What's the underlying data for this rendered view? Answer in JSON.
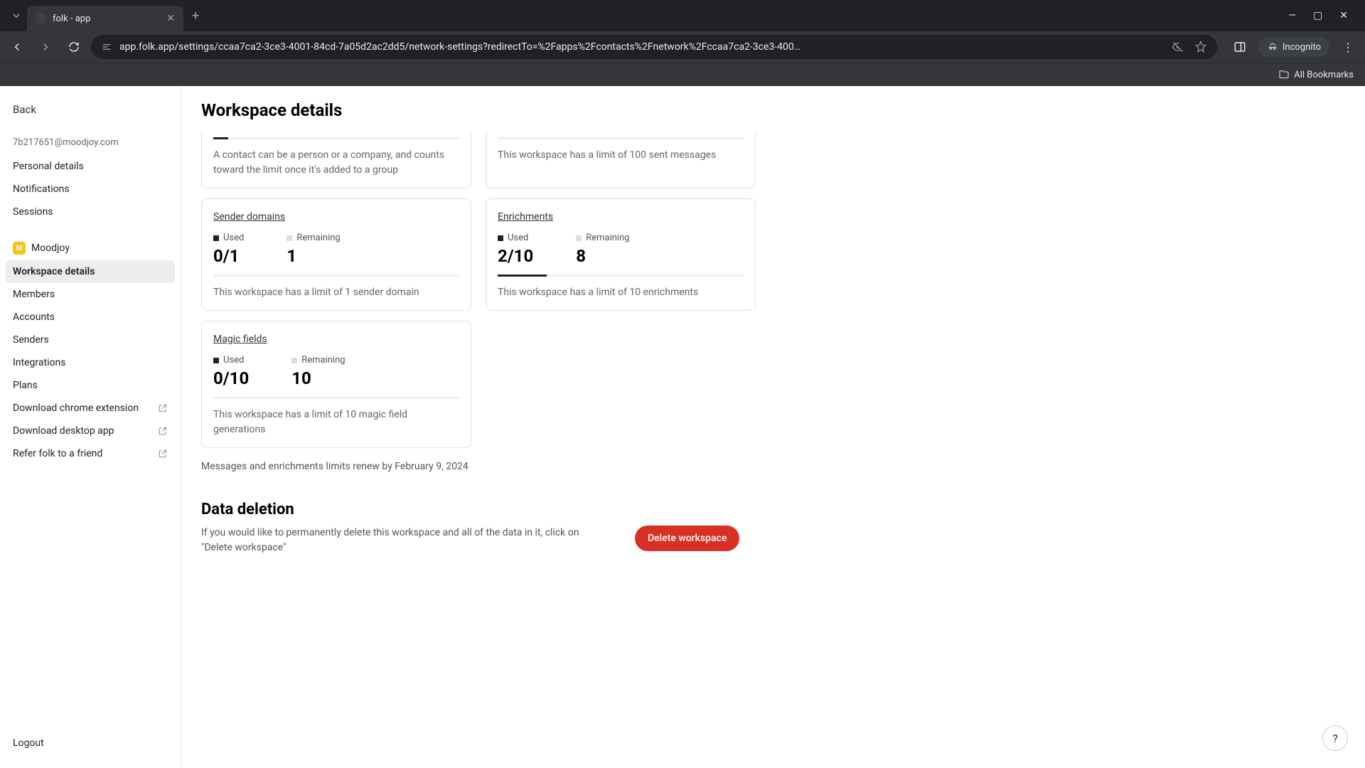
{
  "browser": {
    "tab_title": "folk - app",
    "url": "app.folk.app/settings/ccaa7ca2-3ce3-4001-84cd-7a05d2ac2dd5/network-settings?redirectTo=%2Fapps%2Fcontacts%2Fnetwork%2Fccaa7ca2-3ce3-400…",
    "incognito_label": "Incognito",
    "all_bookmarks": "All Bookmarks"
  },
  "sidebar": {
    "back": "Back",
    "email": "7b217651@moodjoy.com",
    "items": {
      "personal": "Personal details",
      "notifications": "Notifications",
      "sessions": "Sessions",
      "workspace_name": "Moodjoy",
      "workspace_details": "Workspace details",
      "members": "Members",
      "accounts": "Accounts",
      "senders": "Senders",
      "integrations": "Integrations",
      "plans": "Plans",
      "chrome_ext": "Download chrome extension",
      "desktop_app": "Download desktop app",
      "refer": "Refer folk to a friend",
      "logout": "Logout"
    }
  },
  "main": {
    "title": "Workspace details",
    "contact_card_desc": "A contact can be a person or a company, and counts toward the limit once it's added to a group",
    "messages_card_desc": "This workspace has a limit of 100 sent messages",
    "sender_domains": {
      "title": "Sender domains",
      "used_label": "Used",
      "used_value": "0/1",
      "remaining_label": "Remaining",
      "remaining_value": "1",
      "desc": "This workspace has a limit of 1 sender domain"
    },
    "enrichments": {
      "title": "Enrichments",
      "used_label": "Used",
      "used_value": "2/10",
      "remaining_label": "Remaining",
      "remaining_value": "8",
      "desc": "This workspace has a limit of 10 enrichments"
    },
    "magic_fields": {
      "title": "Magic fields",
      "used_label": "Used",
      "used_value": "0/10",
      "remaining_label": "Remaining",
      "remaining_value": "10",
      "desc": "This workspace has a limit of 10 magic field generations"
    },
    "renew_text": "Messages and enrichments limits renew by February 9, 2024",
    "deletion": {
      "title": "Data deletion",
      "desc": "If you would like to permanently delete this workspace and all of the data in it, click on \"Delete workspace\"",
      "button": "Delete workspace"
    }
  },
  "help": "?"
}
